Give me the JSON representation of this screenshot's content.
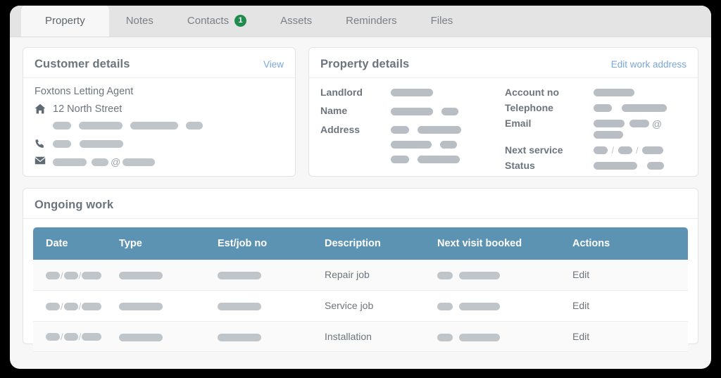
{
  "tabs": [
    {
      "label": "Property",
      "active": true,
      "badge": null
    },
    {
      "label": "Notes",
      "active": false,
      "badge": null
    },
    {
      "label": "Contacts",
      "active": false,
      "badge": "1"
    },
    {
      "label": "Assets",
      "active": false,
      "badge": null
    },
    {
      "label": "Reminders",
      "active": false,
      "badge": null
    },
    {
      "label": "Files",
      "active": false,
      "badge": null
    }
  ],
  "customer": {
    "title": "Customer details",
    "link_label": "View",
    "company_name": "Foxtons Letting Agent",
    "address_line1": "12 North Street",
    "address_icon": "home-icon",
    "phone_icon": "phone-icon",
    "email_icon": "envelope-icon",
    "redacted_email_at": "@"
  },
  "property": {
    "title": "Property details",
    "link_label": "Edit work address",
    "left_labels": [
      "Landlord",
      "Name",
      "Address"
    ],
    "right_labels": [
      "Account no",
      "Telephone",
      "Email",
      "Next service",
      "Status"
    ],
    "redacted_email_at": "@",
    "date_separator": "/"
  },
  "ongoing": {
    "title": "Ongoing work",
    "columns": [
      "Date",
      "Type",
      "Est/job no",
      "Description",
      "Next visit booked",
      "Actions"
    ],
    "rows": [
      {
        "description": "Repair job",
        "action_label": "Edit"
      },
      {
        "description": "Service job",
        "action_label": "Edit"
      },
      {
        "description": "Installation",
        "action_label": "Edit"
      }
    ]
  },
  "colors": {
    "page_background": "#000000",
    "panel_background": "#f7f7f7",
    "tabbar_background": "#e4e4e4",
    "card_background": "#ffffff",
    "table_header": "#5d93b2",
    "link": "#79a7d6",
    "badge_green": "#1f8b4d",
    "heading_text": "#6c757d",
    "skeleton": "#c0c5ca"
  }
}
